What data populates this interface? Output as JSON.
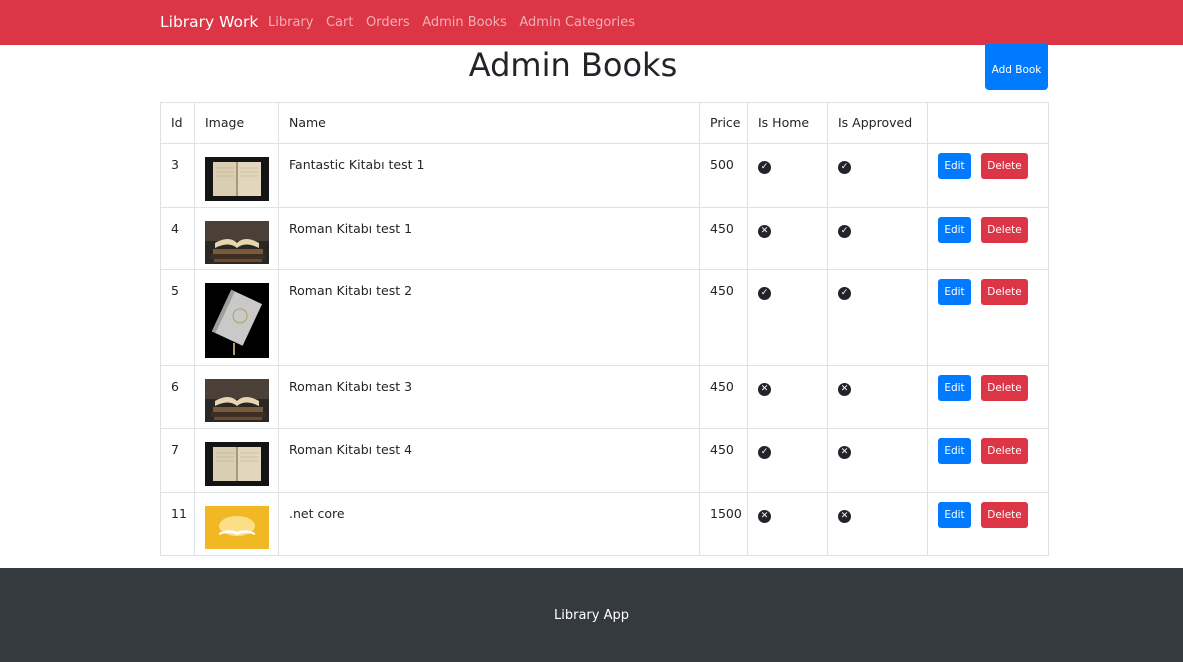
{
  "navbar": {
    "brand": "Library Work",
    "color": "#dc3545",
    "links": [
      {
        "label": "Library"
      },
      {
        "label": "Cart"
      },
      {
        "label": "Orders"
      },
      {
        "label": "Admin Books"
      },
      {
        "label": "Admin Categories"
      }
    ]
  },
  "header": {
    "title": "Admin Books",
    "add_button_label": "Add Book"
  },
  "table": {
    "columns": [
      "Id",
      "Image",
      "Name",
      "Price",
      "Is Home",
      "Is Approved",
      ""
    ],
    "rows": [
      {
        "id": "3",
        "image": "open-book-dark",
        "name": "Fantastic Kitabı test 1",
        "price": "500",
        "is_home": true,
        "is_approved": true,
        "edit": "Edit",
        "delete": "Delete"
      },
      {
        "id": "4",
        "image": "books-stack",
        "name": "Roman Kitabı test 1",
        "price": "450",
        "is_home": false,
        "is_approved": true,
        "edit": "Edit",
        "delete": "Delete"
      },
      {
        "id": "5",
        "image": "white-book",
        "name": "Roman Kitabı test 2",
        "price": "450",
        "is_home": true,
        "is_approved": true,
        "edit": "Edit",
        "delete": "Delete"
      },
      {
        "id": "6",
        "image": "books-stack",
        "name": "Roman Kitabı test 3",
        "price": "450",
        "is_home": false,
        "is_approved": false,
        "edit": "Edit",
        "delete": "Delete"
      },
      {
        "id": "7",
        "image": "open-book-dark",
        "name": "Roman Kitabı test 4",
        "price": "450",
        "is_home": true,
        "is_approved": false,
        "edit": "Edit",
        "delete": "Delete"
      },
      {
        "id": "11",
        "image": "glowing-book-yellow",
        "name": ".net core",
        "price": "1500",
        "is_home": false,
        "is_approved": false,
        "edit": "Edit",
        "delete": "Delete"
      }
    ]
  },
  "footer": {
    "text": "Library App",
    "color": "#343a40"
  },
  "colors": {
    "primary": "#007bff",
    "danger": "#dc3545"
  },
  "icons": {
    "check": "check-circle-icon",
    "cross": "times-circle-icon"
  }
}
